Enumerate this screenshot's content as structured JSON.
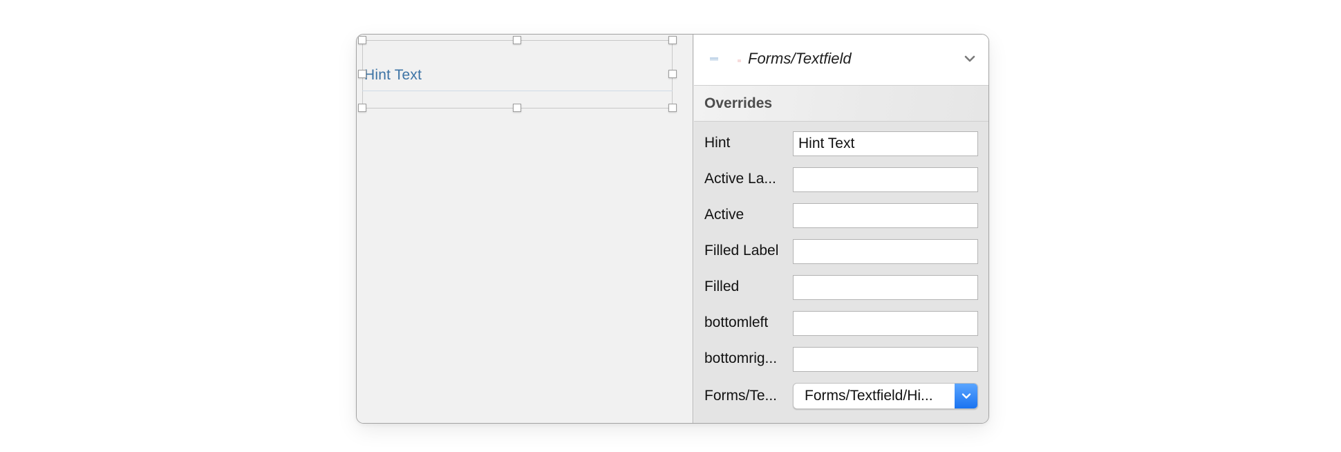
{
  "canvas": {
    "textfield_hint": "Hint Text"
  },
  "inspector": {
    "symbol_name": "Forms/Textfield",
    "thumbnail_icon": "symbol-thumbnail-icon",
    "collapse_icon": "chevron-down-icon",
    "overrides_title": "Overrides",
    "overrides": [
      {
        "label": "Hint",
        "value": "Hint Text"
      },
      {
        "label": "Active La...",
        "value": ""
      },
      {
        "label": "Active",
        "value": ""
      },
      {
        "label": "Filled Label",
        "value": ""
      },
      {
        "label": "Filled",
        "value": ""
      },
      {
        "label": "bottomleft",
        "value": ""
      },
      {
        "label": "bottomrig...",
        "value": ""
      }
    ],
    "symbol_override": {
      "label": "Forms/Te...",
      "selected": "Forms/Textfield/Hi...",
      "arrow_icon": "chevron-down-icon"
    }
  },
  "colors": {
    "hint_text": "#3c73a5",
    "select_accent": "#1a73f0"
  }
}
